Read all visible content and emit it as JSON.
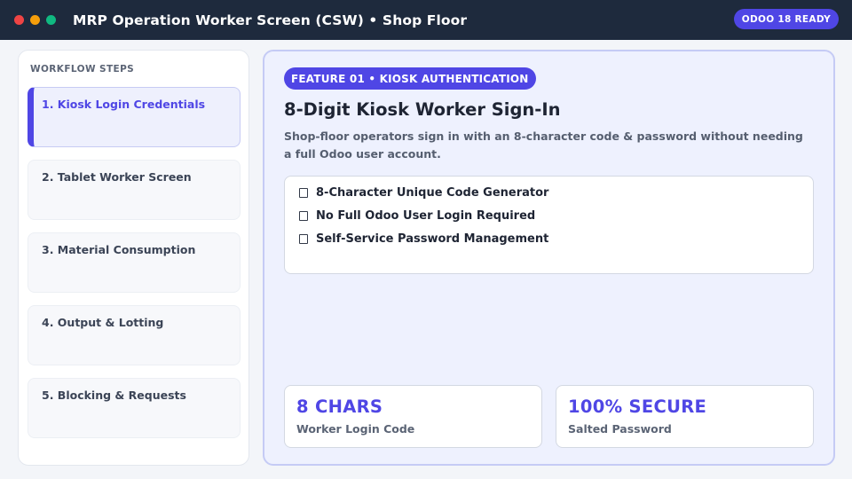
{
  "window": {
    "title": "MRP Operation Worker Screen (CSW) • Shop Floor",
    "controls": [
      {
        "name": "close",
        "color": "#ef4444"
      },
      {
        "name": "minimize",
        "color": "#f59e0b"
      },
      {
        "name": "maximize",
        "color": "#10b981"
      }
    ],
    "badge": "ODOO 18 READY"
  },
  "colors": {
    "accent": "#4f46e5",
    "header_bg": "#1e2a3d"
  },
  "sidebar": {
    "heading": "WORKFLOW STEPS",
    "active_index": 0,
    "steps": [
      {
        "label": "1. Kiosk Login Credentials"
      },
      {
        "label": "2. Tablet Worker Screen"
      },
      {
        "label": "3. Material Consumption"
      },
      {
        "label": "4. Output & Lotting"
      },
      {
        "label": "5. Blocking & Requests"
      }
    ]
  },
  "main": {
    "pill": "FEATURE 01 • KIOSK AUTHENTICATION",
    "title": "8-Digit Kiosk Worker Sign-In",
    "description": "Shop-floor operators sign in with an 8-character code & password without needing a full Odoo user account.",
    "bullets": [
      {
        "icon": "checkbox-icon",
        "text": "8-Character Unique Code Generator"
      },
      {
        "icon": "checkbox-icon",
        "text": "No Full Odoo User Login Required"
      },
      {
        "icon": "checkbox-icon",
        "text": "Self-Service Password Management"
      }
    ],
    "stats": [
      {
        "value": "8 CHARS",
        "label": "Worker Login Code"
      },
      {
        "value": "100% SECURE",
        "label": "Salted Password"
      }
    ]
  }
}
